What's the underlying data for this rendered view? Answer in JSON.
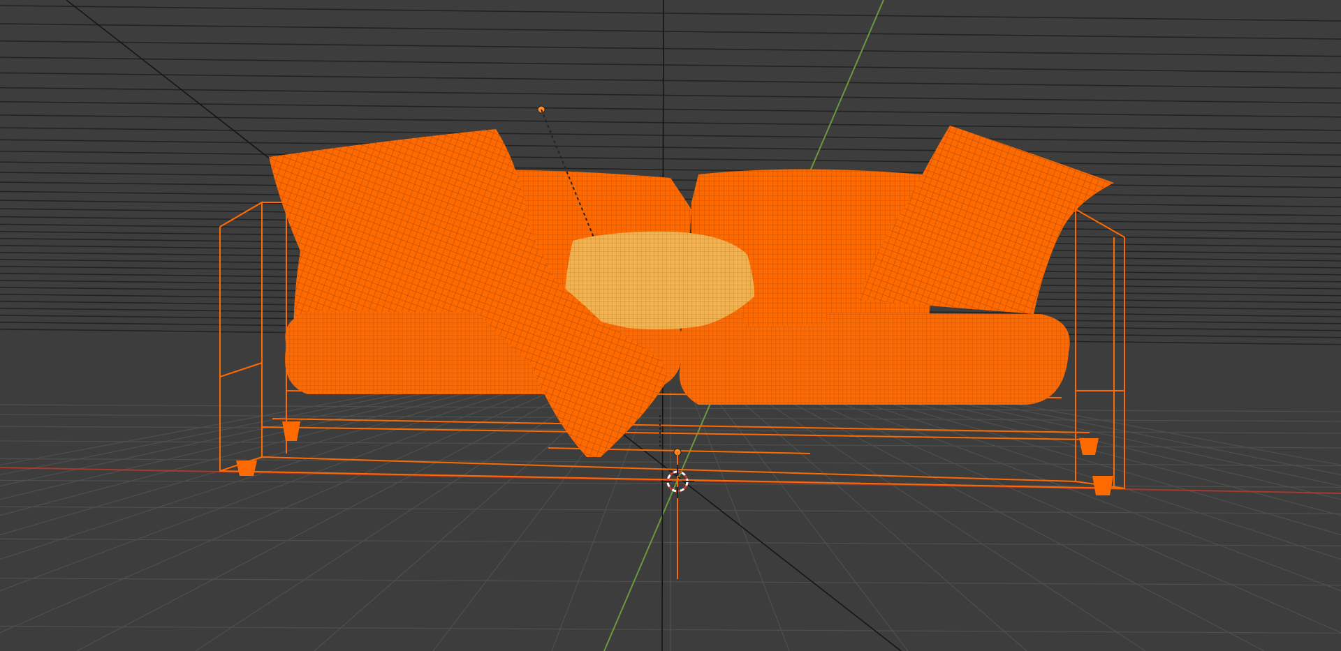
{
  "viewport": {
    "background_color": "#3d3d3d",
    "grid_color": "#4f4f4f",
    "horizon_line_color": "#1e1e1e",
    "x_axis_color": "#c0392b",
    "y_axis_color": "#6a9a3a",
    "view_axis_color": "#151515"
  },
  "scene": {
    "selection_color": "#ff6a00",
    "active_selection_color": "#f2a84a",
    "wire_color": "#8a3a12",
    "objects": [
      {
        "name": "sofa-frame",
        "selected": true,
        "active": false
      },
      {
        "name": "seat-cushion-left",
        "selected": true,
        "active": false
      },
      {
        "name": "seat-cushion-right",
        "selected": true,
        "active": false
      },
      {
        "name": "back-cushion-left",
        "selected": true,
        "active": false
      },
      {
        "name": "back-cushion-right",
        "selected": true,
        "active": false
      },
      {
        "name": "pillow-left",
        "selected": true,
        "active": false
      },
      {
        "name": "pillow-right",
        "selected": true,
        "active": false
      },
      {
        "name": "pillow-center",
        "selected": true,
        "active": true
      },
      {
        "name": "throw-blanket",
        "selected": true,
        "active": false
      },
      {
        "name": "small-pillow",
        "selected": true,
        "active": false
      }
    ]
  },
  "cursor_3d": {
    "ring_color_a": "#ffffff",
    "ring_color_b": "#d0392b"
  }
}
